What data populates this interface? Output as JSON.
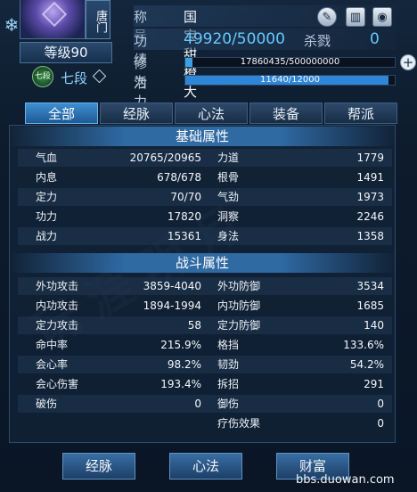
{
  "header": {
    "sect": "唐门",
    "level": "等级90",
    "rank_badge": "七段",
    "rank": "七段",
    "title_label": "称号",
    "title_value": "国宝甜橙大喵",
    "merit_label": "功绩",
    "merit_value": "49920/50000",
    "kill_label": "杀戮",
    "kill_value": "0",
    "cultivation_label": "修为",
    "cultivation_value": "17860435/500000000",
    "cultivation_progress": 0.0357,
    "vitality_label": "活力",
    "vitality_value": "11640/12000",
    "vitality_progress": 0.97,
    "icons": [
      "edit-icon",
      "barcode-icon",
      "eye-icon",
      "plus-icon",
      "snowflake-icon"
    ]
  },
  "tabs": [
    "全部",
    "经脉",
    "心法",
    "装备",
    "帮派"
  ],
  "active_tab": "全部",
  "basic": {
    "title": "基础属性",
    "rows": [
      {
        "k1": "气血",
        "v1": "20765/20965",
        "k2": "力道",
        "v2": "1779"
      },
      {
        "k1": "内息",
        "v1": "678/678",
        "k2": "根骨",
        "v2": "1491"
      },
      {
        "k1": "定力",
        "v1": "70/70",
        "k2": "气劲",
        "v2": "1973"
      },
      {
        "k1": "功力",
        "v1": "17820",
        "k2": "洞察",
        "v2": "2246"
      },
      {
        "k1": "战力",
        "v1": "15361",
        "k2": "身法",
        "v2": "1358"
      }
    ]
  },
  "combat": {
    "title": "战斗属性",
    "rows": [
      {
        "k1": "外功攻击",
        "v1": "3859-4040",
        "k2": "外功防御",
        "v2": "3534"
      },
      {
        "k1": "内功攻击",
        "v1": "1894-1994",
        "k2": "内功防御",
        "v2": "1685"
      },
      {
        "k1": "定力攻击",
        "v1": "58",
        "k2": "定力防御",
        "v2": "140"
      },
      {
        "k1": "命中率",
        "v1": "215.9%",
        "k2": "格挡",
        "v2": "133.6%"
      },
      {
        "k1": "会心率",
        "v1": "98.2%",
        "k2": "韧劲",
        "v2": "54.2%"
      },
      {
        "k1": "会心伤害",
        "v1": "193.4%",
        "k2": "拆招",
        "v2": "291"
      },
      {
        "k1": "破伤",
        "v1": "0",
        "k2": "御伤",
        "v2": "0"
      },
      {
        "k1": "",
        "v1": "",
        "k2": "疗伤效果",
        "v2": "0"
      }
    ]
  },
  "bottom_buttons": [
    "经脉",
    "心法",
    "财富"
  ],
  "site": "bbs.duowan.com",
  "colors": {
    "accent": "#67c9ff",
    "tab_active": "#2f7bc0",
    "cultivation_bar": "#3aa0e8",
    "vitality_bar": "#2f86d6"
  }
}
